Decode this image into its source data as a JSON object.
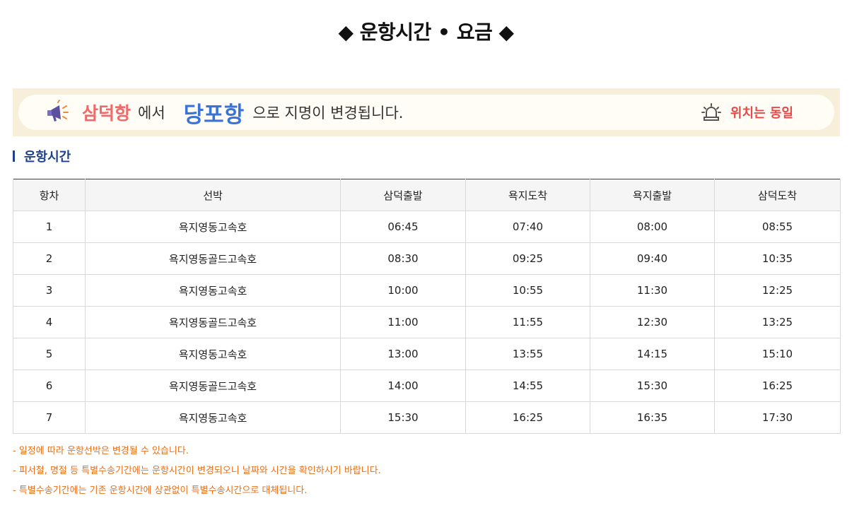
{
  "page": {
    "title": "◆ 운항시간 • 요금 ◆"
  },
  "banner": {
    "old_name": "삼덕항",
    "connector": "에서",
    "new_name": "당포항",
    "tail": "으로 지명이 변경됩니다.",
    "location_label": "위치는 동일",
    "left_icon": "megaphone-icon",
    "right_icon": "siren-icon",
    "colors": {
      "old": "#ef6a6a",
      "new": "#3a73d8",
      "location": "#e84848",
      "background": "#f7efd9"
    }
  },
  "section": {
    "title": "운항시간",
    "accent_color": "#1e3f8a"
  },
  "schedule": {
    "headers": [
      "항차",
      "선박",
      "삼덕출발",
      "욕지도착",
      "욕지출발",
      "삼덕도착"
    ],
    "rows": [
      [
        "1",
        "욕지영동고속호",
        "06:45",
        "07:40",
        "08:00",
        "08:55"
      ],
      [
        "2",
        "욕지영동골드고속호",
        "08:30",
        "09:25",
        "09:40",
        "10:35"
      ],
      [
        "3",
        "욕지영동고속호",
        "10:00",
        "10:55",
        "11:30",
        "12:25"
      ],
      [
        "4",
        "욕지영동골드고속호",
        "11:00",
        "11:55",
        "12:30",
        "13:25"
      ],
      [
        "5",
        "욕지영동고속호",
        "13:00",
        "13:55",
        "14:15",
        "15:10"
      ],
      [
        "6",
        "욕지영동골드고속호",
        "14:00",
        "14:55",
        "15:30",
        "16:25"
      ],
      [
        "7",
        "욕지영동고속호",
        "15:30",
        "16:25",
        "16:35",
        "17:30"
      ]
    ]
  },
  "notes": [
    "- 일정에 따라 운항선박은 변경될 수 있습니다.",
    "- 피서철, 명절 등 특별수송기간에는 운항시간이 변경되오니 날짜와 시간을 확인하시기 바랍니다.",
    "- 특별수송기간에는 기존 운항시간에 상관없이 특별수송시간으로 대체됩니다."
  ]
}
